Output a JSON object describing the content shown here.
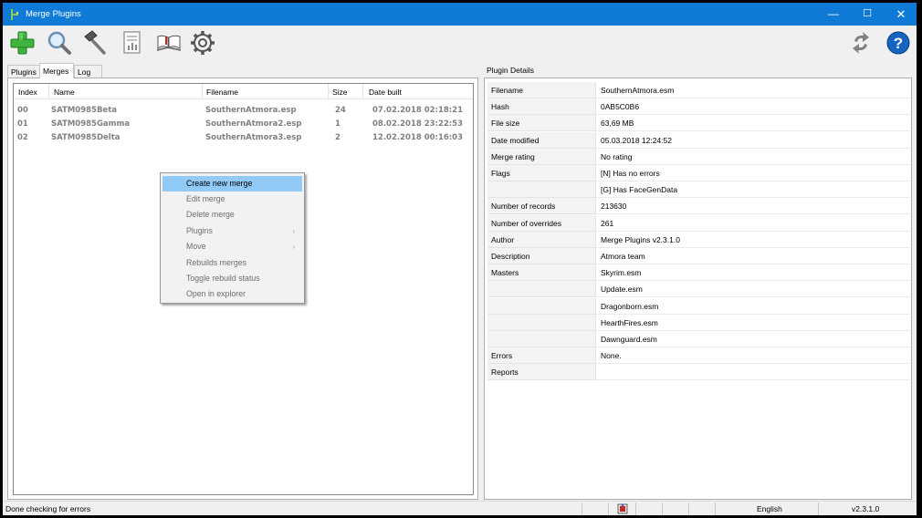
{
  "window": {
    "title": "Merge Plugins",
    "controls": [
      "minimize-icon",
      "maximize-icon",
      "close-icon"
    ]
  },
  "toolbar": {
    "buttons": [
      "create-merge-icon",
      "search-icon",
      "hammer-icon",
      "report-icon",
      "dictionary-icon",
      "settings-gear-icon"
    ],
    "right_buttons": [
      "refresh-icon",
      "help-icon"
    ],
    "colors": {
      "add": "#2fa52f",
      "help": "#1565c0"
    }
  },
  "left": {
    "tabs": [
      "Plugins",
      "Merges",
      "Log"
    ],
    "active_tab": "Merges",
    "columns": [
      "Index",
      "Name",
      "Filename",
      "Size",
      "Date built"
    ],
    "rows": [
      {
        "index": "00",
        "name": "SATM0985Beta",
        "filename": "SouthernAtmora.esp",
        "size": "24",
        "date": "07.02.2018 02:18:21"
      },
      {
        "index": "01",
        "name": "SATM0985Gamma",
        "filename": "SouthernAtmora2.esp",
        "size": "1",
        "date": "08.02.2018 23:22:53"
      },
      {
        "index": "02",
        "name": "SATM0985Delta",
        "filename": "SouthernAtmora3.esp",
        "size": "2",
        "date": "12.02.2018 00:16:03"
      }
    ]
  },
  "context_menu": {
    "items": [
      {
        "label": "Create new merge",
        "highlighted": true
      },
      {
        "label": "Edit merge"
      },
      {
        "label": "Delete merge"
      },
      {
        "label": "Plugins",
        "submenu": true
      },
      {
        "label": "Move",
        "submenu": true
      },
      {
        "label": "Rebuilds merges"
      },
      {
        "label": "Toggle rebuild status"
      },
      {
        "label": "Open in explorer"
      }
    ],
    "highlight_color": "#91c9f7"
  },
  "details": {
    "title": "Plugin Details",
    "rows": [
      {
        "key": "Filename",
        "value": "SouthernAtmora.esm"
      },
      {
        "key": "Hash",
        "value": "0AB5C0B6"
      },
      {
        "key": "File size",
        "value": "63,69 MB"
      },
      {
        "key": "Date modified",
        "value": "05.03.2018 12:24:52"
      },
      {
        "key": "Merge rating",
        "value": "No rating"
      },
      {
        "key": "Flags",
        "value": "[N] Has no errors"
      },
      {
        "key": "",
        "value": "[G] Has FaceGenData"
      },
      {
        "key": "Number of records",
        "value": "213630"
      },
      {
        "key": "Number of overrides",
        "value": "261"
      },
      {
        "key": "Author",
        "value": "Merge Plugins v2.3.1.0"
      },
      {
        "key": "Description",
        "value": "Atmora team"
      },
      {
        "key": "Masters",
        "value": "Skyrim.esm"
      },
      {
        "key": "",
        "value": "Update.esm"
      },
      {
        "key": "",
        "value": "Dragonborn.esm"
      },
      {
        "key": "",
        "value": "HearthFires.esm"
      },
      {
        "key": "",
        "value": "Dawnguard.esm"
      },
      {
        "key": "Errors",
        "value": "None."
      },
      {
        "key": "Reports",
        "value": ""
      }
    ]
  },
  "status": {
    "message": "Done checking for errors",
    "language": "English",
    "version": "v2.3.1.0"
  }
}
